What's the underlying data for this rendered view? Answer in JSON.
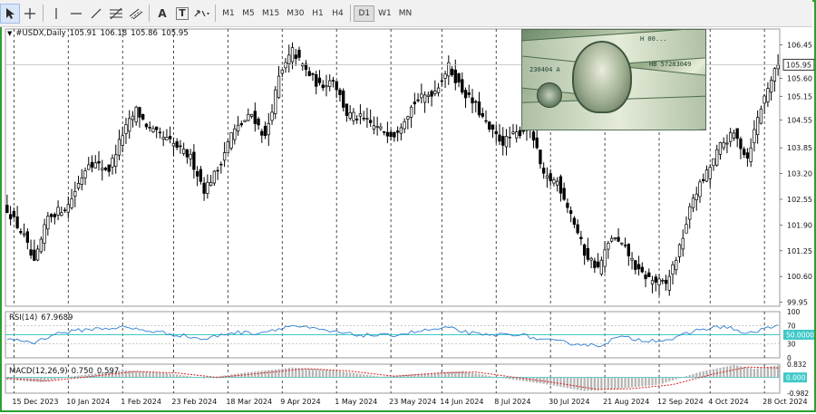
{
  "toolbar": {
    "tools": [
      "cursor-icon",
      "crosshair-icon",
      "vertical-line-icon",
      "horizontal-line-icon",
      "trendline-icon",
      "fibonacci-icon",
      "equidistant-channel-icon",
      "text-icon",
      "text-label-icon",
      "arrows-icon"
    ],
    "text_tool_label": "A",
    "text_label_tool_label": "T",
    "timeframes": [
      "M1",
      "M5",
      "M15",
      "M30",
      "H1",
      "H4",
      "D1",
      "W1",
      "MN"
    ],
    "active_timeframe": "D1"
  },
  "legend": {
    "symbol": "#USDX,Daily",
    "open": "105.91",
    "high": "106.18",
    "low": "105.86",
    "close": "105.95"
  },
  "rsi_legend": {
    "name": "RSI(14)",
    "value": "67.9689"
  },
  "macd_legend": {
    "name": "MACD(12,26,9)",
    "main": "0.750",
    "signal": "0.597"
  },
  "chart_data": [
    {
      "type": "candlestick",
      "title": "#USDX,Daily",
      "current_price": 105.95,
      "current_price_label": "105.95",
      "ylim": [
        99.85,
        106.85
      ],
      "yticks": [
        "106.45",
        "105.60",
        "105.15",
        "104.55",
        "103.85",
        "103.20",
        "102.55",
        "101.90",
        "101.25",
        "100.60",
        "99.95"
      ],
      "xticks": [
        "15 Dec 2023",
        "10 Jan 2024",
        "1 Feb 2024",
        "23 Feb 2024",
        "18 Mar 2024",
        "9 Apr 2024",
        "1 May 2024",
        "23 May 2024",
        "14 Jun 2024",
        "8 Jul 2024",
        "30 Jul 2024",
        "21 Aug 2024",
        "12 Sep 2024",
        "4 Oct 2024",
        "28 Oct 2024"
      ],
      "grid": true,
      "close_path": [
        {
          "bar": 0,
          "close": 102.3
        },
        {
          "bar": 5,
          "close": 101.6
        },
        {
          "bar": 8,
          "close": 100.9
        },
        {
          "bar": 12,
          "close": 102.1
        },
        {
          "bar": 18,
          "close": 102.4
        },
        {
          "bar": 24,
          "close": 103.5
        },
        {
          "bar": 30,
          "close": 103.3
        },
        {
          "bar": 34,
          "close": 104.2
        },
        {
          "bar": 38,
          "close": 104.8
        },
        {
          "bar": 42,
          "close": 104.3
        },
        {
          "bar": 48,
          "close": 104.0
        },
        {
          "bar": 54,
          "close": 103.6
        },
        {
          "bar": 58,
          "close": 102.8
        },
        {
          "bar": 62,
          "close": 103.3
        },
        {
          "bar": 66,
          "close": 104.2
        },
        {
          "bar": 72,
          "close": 104.7
        },
        {
          "bar": 76,
          "close": 104.1
        },
        {
          "bar": 80,
          "close": 105.6
        },
        {
          "bar": 84,
          "close": 106.3
        },
        {
          "bar": 88,
          "close": 105.8
        },
        {
          "bar": 92,
          "close": 105.4
        },
        {
          "bar": 96,
          "close": 105.6
        },
        {
          "bar": 100,
          "close": 104.7
        },
        {
          "bar": 104,
          "close": 104.6
        },
        {
          "bar": 110,
          "close": 104.3
        },
        {
          "bar": 114,
          "close": 104.2
        },
        {
          "bar": 120,
          "close": 105.0
        },
        {
          "bar": 126,
          "close": 105.3
        },
        {
          "bar": 130,
          "close": 105.9
        },
        {
          "bar": 134,
          "close": 105.3
        },
        {
          "bar": 138,
          "close": 104.9
        },
        {
          "bar": 142,
          "close": 104.3
        },
        {
          "bar": 146,
          "close": 104.0
        },
        {
          "bar": 150,
          "close": 104.2
        },
        {
          "bar": 154,
          "close": 104.4
        },
        {
          "bar": 158,
          "close": 103.1
        },
        {
          "bar": 162,
          "close": 103.0
        },
        {
          "bar": 166,
          "close": 102.2
        },
        {
          "bar": 170,
          "close": 101.2
        },
        {
          "bar": 174,
          "close": 100.8
        },
        {
          "bar": 178,
          "close": 101.6
        },
        {
          "bar": 182,
          "close": 101.3
        },
        {
          "bar": 186,
          "close": 100.7
        },
        {
          "bar": 190,
          "close": 100.5
        },
        {
          "bar": 194,
          "close": 100.4
        },
        {
          "bar": 198,
          "close": 101.3
        },
        {
          "bar": 202,
          "close": 102.6
        },
        {
          "bar": 206,
          "close": 103.2
        },
        {
          "bar": 210,
          "close": 103.9
        },
        {
          "bar": 214,
          "close": 104.2
        },
        {
          "bar": 218,
          "close": 103.6
        },
        {
          "bar": 221,
          "close": 104.6
        },
        {
          "bar": 224,
          "close": 105.4
        },
        {
          "bar": 227,
          "close": 105.95
        }
      ]
    },
    {
      "type": "line",
      "title": "RSI(14)",
      "last_value": 67.9689,
      "ylim": [
        0,
        100
      ],
      "yticks": [
        "100",
        "70",
        "30",
        "0"
      ],
      "current_level_label": "50.0000",
      "levels": [
        70,
        50,
        30
      ],
      "values": [
        {
          "bar": 0,
          "v": 42
        },
        {
          "bar": 8,
          "v": 33
        },
        {
          "bar": 14,
          "v": 52
        },
        {
          "bar": 24,
          "v": 62
        },
        {
          "bar": 34,
          "v": 66
        },
        {
          "bar": 42,
          "v": 58
        },
        {
          "bar": 52,
          "v": 48
        },
        {
          "bar": 58,
          "v": 40
        },
        {
          "bar": 66,
          "v": 55
        },
        {
          "bar": 74,
          "v": 54
        },
        {
          "bar": 84,
          "v": 70
        },
        {
          "bar": 92,
          "v": 60
        },
        {
          "bar": 102,
          "v": 50
        },
        {
          "bar": 112,
          "v": 48
        },
        {
          "bar": 124,
          "v": 60
        },
        {
          "bar": 130,
          "v": 64
        },
        {
          "bar": 140,
          "v": 48
        },
        {
          "bar": 150,
          "v": 52
        },
        {
          "bar": 158,
          "v": 38
        },
        {
          "bar": 166,
          "v": 32
        },
        {
          "bar": 174,
          "v": 26
        },
        {
          "bar": 180,
          "v": 45
        },
        {
          "bar": 188,
          "v": 38
        },
        {
          "bar": 196,
          "v": 40
        },
        {
          "bar": 204,
          "v": 62
        },
        {
          "bar": 212,
          "v": 68
        },
        {
          "bar": 218,
          "v": 50
        },
        {
          "bar": 222,
          "v": 62
        },
        {
          "bar": 227,
          "v": 68
        }
      ]
    },
    {
      "type": "histogram",
      "title": "MACD(12,26,9)",
      "main": 0.75,
      "signal": 0.597,
      "ylim": [
        -0.982,
        0.832
      ],
      "yticks": [
        "0.832",
        "0.000",
        "-0.982"
      ],
      "main_values": [
        {
          "bar": 0,
          "v": -0.15
        },
        {
          "bar": 10,
          "v": -0.3
        },
        {
          "bar": 20,
          "v": 0.1
        },
        {
          "bar": 34,
          "v": 0.45
        },
        {
          "bar": 46,
          "v": 0.3
        },
        {
          "bar": 58,
          "v": -0.05
        },
        {
          "bar": 70,
          "v": 0.3
        },
        {
          "bar": 84,
          "v": 0.62
        },
        {
          "bar": 96,
          "v": 0.45
        },
        {
          "bar": 110,
          "v": 0.05
        },
        {
          "bar": 126,
          "v": 0.3
        },
        {
          "bar": 134,
          "v": 0.4
        },
        {
          "bar": 146,
          "v": -0.05
        },
        {
          "bar": 158,
          "v": -0.4
        },
        {
          "bar": 170,
          "v": -0.85
        },
        {
          "bar": 180,
          "v": -0.7
        },
        {
          "bar": 192,
          "v": -0.45
        },
        {
          "bar": 204,
          "v": 0.35
        },
        {
          "bar": 214,
          "v": 0.78
        },
        {
          "bar": 220,
          "v": 0.55
        },
        {
          "bar": 227,
          "v": 0.75
        }
      ],
      "signal_values": [
        {
          "bar": 0,
          "v": -0.05
        },
        {
          "bar": 12,
          "v": -0.22
        },
        {
          "bar": 24,
          "v": 0.05
        },
        {
          "bar": 38,
          "v": 0.38
        },
        {
          "bar": 50,
          "v": 0.28
        },
        {
          "bar": 62,
          "v": 0.0
        },
        {
          "bar": 74,
          "v": 0.25
        },
        {
          "bar": 88,
          "v": 0.55
        },
        {
          "bar": 100,
          "v": 0.42
        },
        {
          "bar": 114,
          "v": 0.08
        },
        {
          "bar": 128,
          "v": 0.28
        },
        {
          "bar": 138,
          "v": 0.34
        },
        {
          "bar": 150,
          "v": 0.0
        },
        {
          "bar": 162,
          "v": -0.35
        },
        {
          "bar": 174,
          "v": -0.75
        },
        {
          "bar": 184,
          "v": -0.7
        },
        {
          "bar": 196,
          "v": -0.45
        },
        {
          "bar": 208,
          "v": 0.22
        },
        {
          "bar": 218,
          "v": 0.65
        },
        {
          "bar": 227,
          "v": 0.597
        }
      ]
    }
  ],
  "photo": {
    "serial_top": "H 00...",
    "serial_side": "HB 57283049",
    "serial_left": "230404 A"
  }
}
